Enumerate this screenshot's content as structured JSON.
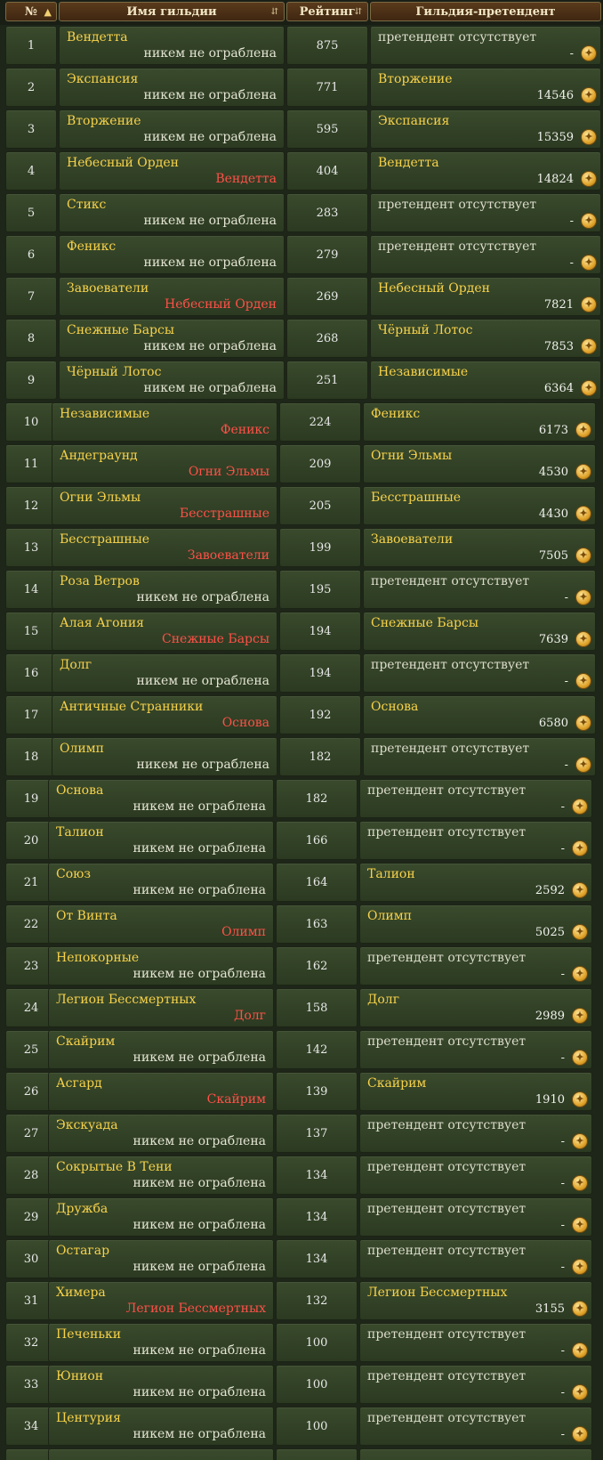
{
  "headers": {
    "num": "№",
    "name": "Имя гильдии",
    "rating": "Рейтинг",
    "claimant": "Гильдия-претендент"
  },
  "rows": [
    {
      "num": "1",
      "name": "Вендетта",
      "robbed": "никем не ограблена",
      "robbed_by": false,
      "rating": "875",
      "claimant": "претендент отсутствует",
      "has_claimant": false,
      "bid": "-"
    },
    {
      "num": "2",
      "name": "Экспансия",
      "robbed": "никем не ограблена",
      "robbed_by": false,
      "rating": "771",
      "claimant": "Вторжение",
      "has_claimant": true,
      "bid": "14546"
    },
    {
      "num": "3",
      "name": "Вторжение",
      "robbed": "никем не ограблена",
      "robbed_by": false,
      "rating": "595",
      "claimant": "Экспансия",
      "has_claimant": true,
      "bid": "15359"
    },
    {
      "num": "4",
      "name": "Небесный Орден",
      "robbed": "Вендетта",
      "robbed_by": true,
      "rating": "404",
      "claimant": "Вендетта",
      "has_claimant": true,
      "bid": "14824"
    },
    {
      "num": "5",
      "name": "Стикс",
      "robbed": "никем не ограблена",
      "robbed_by": false,
      "rating": "283",
      "claimant": "претендент отсутствует",
      "has_claimant": false,
      "bid": "-"
    },
    {
      "num": "6",
      "name": "Феникс",
      "robbed": "никем не ограблена",
      "robbed_by": false,
      "rating": "279",
      "claimant": "претендент отсутствует",
      "has_claimant": false,
      "bid": "-"
    },
    {
      "num": "7",
      "name": "Завоеватели",
      "robbed": "Небесный Орден",
      "robbed_by": true,
      "rating": "269",
      "claimant": "Небесный Орден",
      "has_claimant": true,
      "bid": "7821"
    },
    {
      "num": "8",
      "name": "Снежные Барсы",
      "robbed": "никем не ограблена",
      "robbed_by": false,
      "rating": "268",
      "claimant": "Чёрный Лотос",
      "has_claimant": true,
      "bid": "7853"
    },
    {
      "num": "9",
      "name": "Чёрный Лотос",
      "robbed": "никем не ограблена",
      "robbed_by": false,
      "rating": "251",
      "claimant": "Независимые",
      "has_claimant": true,
      "bid": "6364"
    },
    {
      "num": "10",
      "name": "Независимые",
      "robbed": "Феникс",
      "robbed_by": true,
      "rating": "224",
      "claimant": "Феникс",
      "has_claimant": true,
      "bid": "6173"
    },
    {
      "num": "11",
      "name": "Андеграунд",
      "robbed": "Огни Эльмы",
      "robbed_by": true,
      "rating": "209",
      "claimant": "Огни Эльмы",
      "has_claimant": true,
      "bid": "4530"
    },
    {
      "num": "12",
      "name": "Огни Эльмы",
      "robbed": "Бесстрашные",
      "robbed_by": true,
      "rating": "205",
      "claimant": "Бесстрашные",
      "has_claimant": true,
      "bid": "4430"
    },
    {
      "num": "13",
      "name": "Бесстрашные",
      "robbed": "Завоеватели",
      "robbed_by": true,
      "rating": "199",
      "claimant": "Завоеватели",
      "has_claimant": true,
      "bid": "7505"
    },
    {
      "num": "14",
      "name": "Роза Ветров",
      "robbed": "никем не ограблена",
      "robbed_by": false,
      "rating": "195",
      "claimant": "претендент отсутствует",
      "has_claimant": false,
      "bid": "-"
    },
    {
      "num": "15",
      "name": "Алая Агония",
      "robbed": "Снежные Барсы",
      "robbed_by": true,
      "rating": "194",
      "claimant": "Снежные Барсы",
      "has_claimant": true,
      "bid": "7639"
    },
    {
      "num": "16",
      "name": "Долг",
      "robbed": "никем не ограблена",
      "robbed_by": false,
      "rating": "194",
      "claimant": "претендент отсутствует",
      "has_claimant": false,
      "bid": "-"
    },
    {
      "num": "17",
      "name": "Античные Странники",
      "robbed": "Основа",
      "robbed_by": true,
      "rating": "192",
      "claimant": "Основа",
      "has_claimant": true,
      "bid": "6580"
    },
    {
      "num": "18",
      "name": "Олимп",
      "robbed": "никем не ограблена",
      "robbed_by": false,
      "rating": "182",
      "claimant": "претендент отсутствует",
      "has_claimant": false,
      "bid": "-"
    },
    {
      "num": "19",
      "name": "Основа",
      "robbed": "никем не ограблена",
      "robbed_by": false,
      "rating": "182",
      "claimant": "претендент отсутствует",
      "has_claimant": false,
      "bid": "-"
    },
    {
      "num": "20",
      "name": "Талион",
      "robbed": "никем не ограблена",
      "robbed_by": false,
      "rating": "166",
      "claimant": "претендент отсутствует",
      "has_claimant": false,
      "bid": "-"
    },
    {
      "num": "21",
      "name": "Союз",
      "robbed": "никем не ограблена",
      "robbed_by": false,
      "rating": "164",
      "claimant": "Талион",
      "has_claimant": true,
      "bid": "2592"
    },
    {
      "num": "22",
      "name": "От Винта",
      "robbed": "Олимп",
      "robbed_by": true,
      "rating": "163",
      "claimant": "Олимп",
      "has_claimant": true,
      "bid": "5025"
    },
    {
      "num": "23",
      "name": "Непокорные",
      "robbed": "никем не ограблена",
      "robbed_by": false,
      "rating": "162",
      "claimant": "претендент отсутствует",
      "has_claimant": false,
      "bid": "-"
    },
    {
      "num": "24",
      "name": "Легион Бессмертных",
      "robbed": "Долг",
      "robbed_by": true,
      "rating": "158",
      "claimant": "Долг",
      "has_claimant": true,
      "bid": "2989"
    },
    {
      "num": "25",
      "name": "Скайрим",
      "robbed": "никем не ограблена",
      "robbed_by": false,
      "rating": "142",
      "claimant": "претендент отсутствует",
      "has_claimant": false,
      "bid": "-"
    },
    {
      "num": "26",
      "name": "Асгард",
      "robbed": "Скайрим",
      "robbed_by": true,
      "rating": "139",
      "claimant": "Скайрим",
      "has_claimant": true,
      "bid": "1910"
    },
    {
      "num": "27",
      "name": "Экскуада",
      "robbed": "никем не ограблена",
      "robbed_by": false,
      "rating": "137",
      "claimant": "претендент отсутствует",
      "has_claimant": false,
      "bid": "-"
    },
    {
      "num": "28",
      "name": "Сокрытые В Тени",
      "robbed": "никем не ограблена",
      "robbed_by": false,
      "rating": "134",
      "claimant": "претендент отсутствует",
      "has_claimant": false,
      "bid": "-"
    },
    {
      "num": "29",
      "name": "Дружба",
      "robbed": "никем не ограблена",
      "robbed_by": false,
      "rating": "134",
      "claimant": "претендент отсутствует",
      "has_claimant": false,
      "bid": "-"
    },
    {
      "num": "30",
      "name": "Остагар",
      "robbed": "никем не ограблена",
      "robbed_by": false,
      "rating": "134",
      "claimant": "претендент отсутствует",
      "has_claimant": false,
      "bid": "-"
    },
    {
      "num": "31",
      "name": "Химера",
      "robbed": "Легион Бессмертных",
      "robbed_by": true,
      "rating": "132",
      "claimant": "Легион Бессмертных",
      "has_claimant": true,
      "bid": "3155"
    },
    {
      "num": "32",
      "name": "Печеньки",
      "robbed": "никем не ограблена",
      "robbed_by": false,
      "rating": "100",
      "claimant": "претендент отсутствует",
      "has_claimant": false,
      "bid": "-"
    },
    {
      "num": "33",
      "name": "Юнион",
      "robbed": "никем не ограблена",
      "robbed_by": false,
      "rating": "100",
      "claimant": "претендент отсутствует",
      "has_claimant": false,
      "bid": "-"
    },
    {
      "num": "34",
      "name": "Центурия",
      "robbed": "никем не ограблена",
      "robbed_by": false,
      "rating": "100",
      "claimant": "претендент отсутствует",
      "has_claimant": false,
      "bid": "-"
    },
    {
      "num": "",
      "name": "",
      "robbed": "",
      "robbed_by": false,
      "rating": "",
      "claimant": "",
      "has_claimant": false,
      "bid": ""
    }
  ],
  "colors": {
    "gold_name": "#f7d24a",
    "robbed_by": "#ff5048",
    "text_light": "#e4e4d4"
  },
  "icons": {
    "sort": "sort-ascending-icon",
    "coin": "gold-coin-icon"
  }
}
